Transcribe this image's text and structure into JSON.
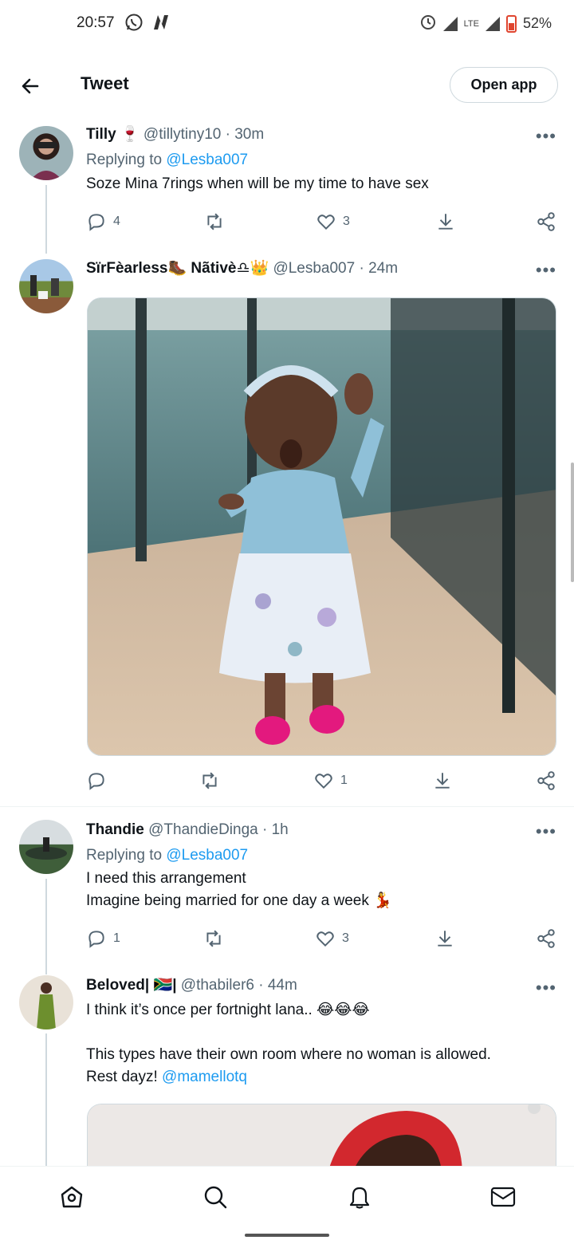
{
  "status_bar": {
    "time": "20:57",
    "left_icons": [
      "whatsapp-icon",
      "n-app-icon"
    ],
    "right_icons": [
      "alarm-icon",
      "signal-icon",
      "lte-icon",
      "signal-icon",
      "battery-icon"
    ],
    "lte": "LTE",
    "battery": "52%"
  },
  "header": {
    "title": "Tweet",
    "open_app": "Open app"
  },
  "colors": {
    "link": "#1d9bf0",
    "secondary_text": "#536471",
    "primary_text": "#0f1419"
  },
  "tweets": [
    {
      "name": "Tilly",
      "name_emoji": "🍷",
      "meta": "@tillytiny10 · 30m",
      "replying_prefix": "Replying to",
      "replying_handle": "@Lesba007",
      "text": "Soze Mina 7rings when will be my time to have sex",
      "replies": "4",
      "retweets": "",
      "likes": "3"
    },
    {
      "name": "SïrFèarless",
      "name_emoji_1": "🥾",
      "name_2": "Nãtivè",
      "name_emoji_2": "♎👑",
      "meta": "@Lesba007 · 24m",
      "replies": "",
      "retweets": "",
      "likes": "1"
    },
    {
      "name": "Thandie",
      "meta": "@ThandieDinga · 1h",
      "replying_prefix": "Replying to",
      "replying_handle": "@Lesba007",
      "text_line1": "I need this arrangement",
      "text_line2": "Imagine being married for one day a week",
      "text_emoji": "💃",
      "replies": "1",
      "retweets": "",
      "likes": "3"
    },
    {
      "name": "Beloved|",
      "name_flag": "🇿🇦",
      "name_end": "|",
      "meta": "@thabiler6 · 44m",
      "text_line1": "I think it’s once per fortnight lana..",
      "text_emoji": "😂😂😂",
      "text_line2": "This types have their own room where no woman is allowed.",
      "text_line3": "Rest dayz!",
      "mention": "@mamellotq"
    }
  ],
  "bottom_nav": [
    "home-icon",
    "search-icon",
    "notifications-icon",
    "messages-icon"
  ]
}
